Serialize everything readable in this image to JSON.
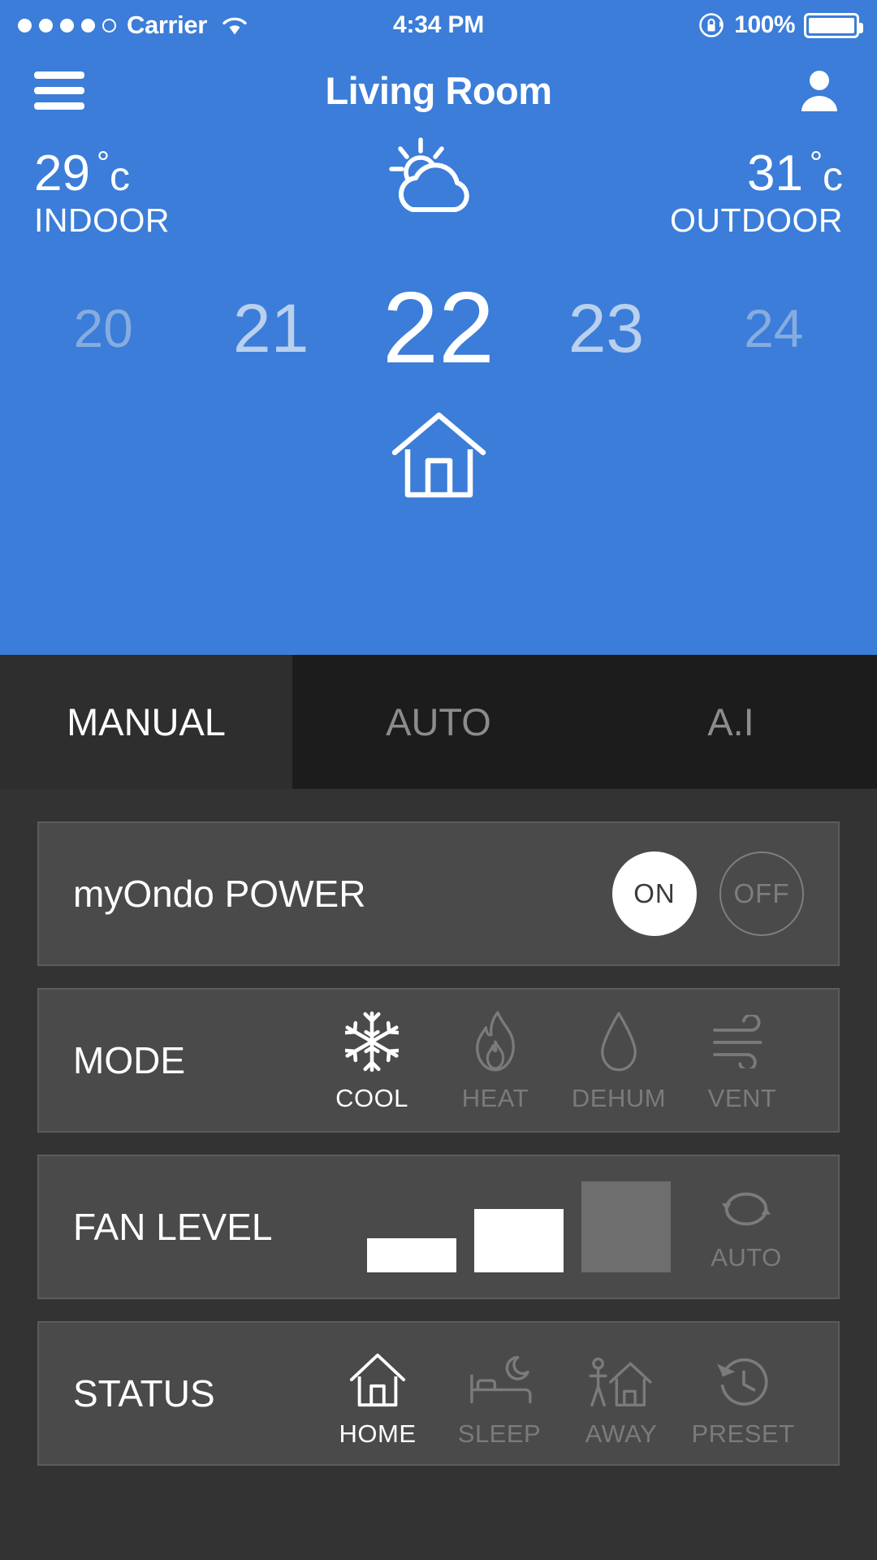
{
  "statusbar": {
    "carrier": "Carrier",
    "time": "4:34 PM",
    "battery_pct": "100%",
    "signal_filled": 4,
    "signal_total": 5
  },
  "header": {
    "title": "Living Room",
    "menu_icon": "hamburger-menu-icon",
    "profile_icon": "user-profile-icon"
  },
  "climate": {
    "indoor": {
      "value": "29",
      "degree": "°",
      "unit": "c",
      "label": "INDOOR"
    },
    "outdoor": {
      "value": "31",
      "degree": "°",
      "unit": "c",
      "label": "OUTDOOR"
    },
    "weather_icon": "sun-behind-cloud-icon",
    "house_icon": "house-outline-icon"
  },
  "temperature_picker": {
    "values": [
      "20",
      "21",
      "22",
      "23",
      "24"
    ],
    "selected": "22",
    "selected_index": 2
  },
  "tabs": [
    {
      "label": "MANUAL",
      "active": true
    },
    {
      "label": "AUTO",
      "active": false
    },
    {
      "label": "A.I",
      "active": false
    }
  ],
  "power": {
    "label": "myOndo POWER",
    "options": [
      {
        "label": "ON",
        "active": true
      },
      {
        "label": "OFF",
        "active": false
      }
    ]
  },
  "mode": {
    "label": "MODE",
    "options": [
      {
        "label": "COOL",
        "icon": "snowflake-icon",
        "active": true
      },
      {
        "label": "HEAT",
        "icon": "flame-icon",
        "active": false
      },
      {
        "label": "DEHUM",
        "icon": "water-droplet-icon",
        "active": false
      },
      {
        "label": "VENT",
        "icon": "wind-icon",
        "active": false
      }
    ]
  },
  "fan_level": {
    "label": "FAN LEVEL",
    "bars": [
      {
        "level": 1,
        "active": true
      },
      {
        "level": 2,
        "active": true
      },
      {
        "level": 3,
        "active": false
      }
    ],
    "auto": {
      "label": "AUTO",
      "icon": "refresh-circular-icon",
      "active": false
    }
  },
  "status": {
    "label": "STATUS",
    "options": [
      {
        "label": "HOME",
        "icon": "house-icon",
        "active": true
      },
      {
        "label": "SLEEP",
        "icon": "bed-moon-icon",
        "active": false
      },
      {
        "label": "AWAY",
        "icon": "person-leaving-house-icon",
        "active": false
      },
      {
        "label": "PRESET",
        "icon": "clock-rewind-icon",
        "active": false
      }
    ]
  },
  "colors": {
    "brand_blue": "#3b7dd8",
    "panel_dark": "#333333",
    "card_bg": "#4a4a4a",
    "active_white": "#ffffff",
    "inactive_gray": "#7b7b7b"
  }
}
